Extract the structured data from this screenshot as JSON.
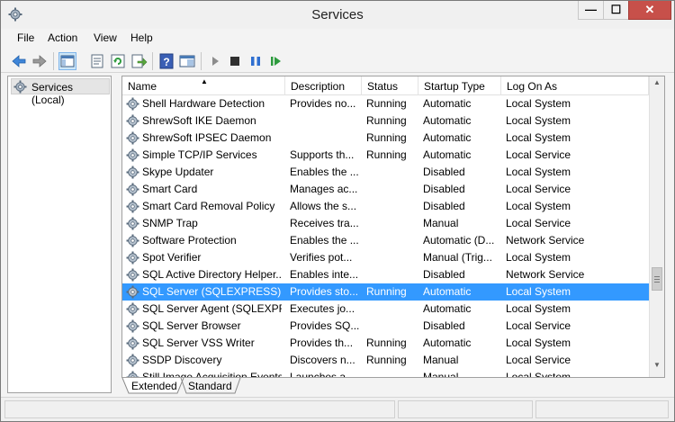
{
  "window": {
    "title": "Services",
    "buttons": {
      "minimize": "—",
      "maximize": "☐",
      "close": "✕"
    }
  },
  "menu": [
    "File",
    "Action",
    "View",
    "Help"
  ],
  "toolbar": {
    "items": [
      "back-icon",
      "forward-icon",
      "console-tree-icon",
      "properties-icon",
      "refresh-icon",
      "export-icon",
      "help-icon",
      "show-hide-icon",
      "start-icon",
      "stop-icon",
      "pause-icon",
      "restart-icon"
    ]
  },
  "tree": {
    "label": "Services (Local)"
  },
  "columns": {
    "name": "Name",
    "description": "Description",
    "status": "Status",
    "startup_type": "Startup Type",
    "log_on_as": "Log On As"
  },
  "services": [
    {
      "name": "Shell Hardware Detection",
      "description": "Provides no...",
      "status": "Running",
      "startup": "Automatic",
      "logon": "Local System"
    },
    {
      "name": "ShrewSoft IKE Daemon",
      "description": "",
      "status": "Running",
      "startup": "Automatic",
      "logon": "Local System"
    },
    {
      "name": "ShrewSoft IPSEC Daemon",
      "description": "",
      "status": "Running",
      "startup": "Automatic",
      "logon": "Local System"
    },
    {
      "name": "Simple TCP/IP Services",
      "description": "Supports th...",
      "status": "Running",
      "startup": "Automatic",
      "logon": "Local Service"
    },
    {
      "name": "Skype Updater",
      "description": "Enables the ...",
      "status": "",
      "startup": "Disabled",
      "logon": "Local System"
    },
    {
      "name": "Smart Card",
      "description": "Manages ac...",
      "status": "",
      "startup": "Disabled",
      "logon": "Local Service"
    },
    {
      "name": "Smart Card Removal Policy",
      "description": "Allows the s...",
      "status": "",
      "startup": "Disabled",
      "logon": "Local System"
    },
    {
      "name": "SNMP Trap",
      "description": "Receives tra...",
      "status": "",
      "startup": "Manual",
      "logon": "Local Service"
    },
    {
      "name": "Software Protection",
      "description": "Enables the ...",
      "status": "",
      "startup": "Automatic (D...",
      "logon": "Network Service"
    },
    {
      "name": "Spot Verifier",
      "description": "Verifies pot...",
      "status": "",
      "startup": "Manual (Trig...",
      "logon": "Local System"
    },
    {
      "name": "SQL Active Directory Helper...",
      "description": "Enables inte...",
      "status": "",
      "startup": "Disabled",
      "logon": "Network Service"
    },
    {
      "name": "SQL Server (SQLEXPRESS)",
      "description": "Provides sto...",
      "status": "Running",
      "startup": "Automatic",
      "logon": "Local System",
      "selected": true
    },
    {
      "name": "SQL Server Agent (SQLEXPR...",
      "description": "Executes jo...",
      "status": "",
      "startup": "Automatic",
      "logon": "Local System"
    },
    {
      "name": "SQL Server Browser",
      "description": "Provides SQ...",
      "status": "",
      "startup": "Disabled",
      "logon": "Local Service"
    },
    {
      "name": "SQL Server VSS Writer",
      "description": "Provides th...",
      "status": "Running",
      "startup": "Automatic",
      "logon": "Local System"
    },
    {
      "name": "SSDP Discovery",
      "description": "Discovers n...",
      "status": "Running",
      "startup": "Manual",
      "logon": "Local Service"
    },
    {
      "name": "Still Image Acquisition Events",
      "description": "Launches a...",
      "status": "",
      "startup": "Manual",
      "logon": "Local System"
    }
  ],
  "tabs": [
    "Extended",
    "Standard"
  ],
  "colors": {
    "selection": "#3399ff",
    "close_button": "#c7504a"
  }
}
